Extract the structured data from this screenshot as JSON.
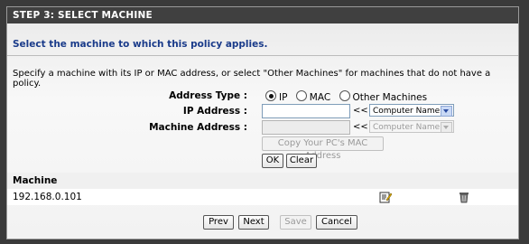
{
  "header": {
    "title": "STEP 3: SELECT MACHINE"
  },
  "description": "Select the machine to which this policy applies.",
  "instructions": "Specify a machine with its IP or MAC address, or select \"Other Machines\" for machines that do not have a policy.",
  "form": {
    "address_type_label": "Address Type :",
    "address_type_options": [
      "IP",
      "MAC",
      "Other Machines"
    ],
    "address_type_selected": "IP",
    "ip_label": "IP Address :",
    "ip_value": "",
    "arrows": "<<",
    "computer_name_select": "Computer Name",
    "machine_label": "Machine Address :",
    "machine_value": "",
    "machine_arrows": "<<",
    "machine_computer_name_select": "Computer Name",
    "copy_mac_button": "Copy Your PC's MAC Address",
    "ok_button": "OK",
    "clear_button": "Clear"
  },
  "table": {
    "header": "Machine",
    "rows": [
      {
        "machine": "192.168.0.101",
        "edit_icon": "edit-icon",
        "delete_icon": "trash-icon"
      }
    ]
  },
  "nav": {
    "prev": "Prev",
    "next": "Next",
    "save": "Save",
    "cancel": "Cancel"
  },
  "colors": {
    "header_bg": "#404040",
    "description": "#1a3b8a"
  }
}
